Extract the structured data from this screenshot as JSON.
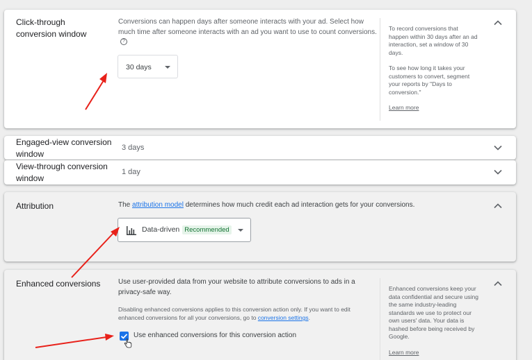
{
  "click_through": {
    "title": "Click-through conversion window",
    "description": "Conversions can happen days after someone interacts with your ad. Select how much time after someone interacts with an ad you want to use to count conversions.",
    "help": "?",
    "selected": "30 days",
    "side_para1": "To record conversions that happen within 30 days after an ad interaction, set a window of 30 days.",
    "side_para2": "To see how long it takes your customers to convert, segment your reports by \"Days to conversion.\"",
    "learn_more": "Learn more"
  },
  "engaged_view": {
    "title": "Engaged-view conversion window",
    "value": "3 days"
  },
  "view_through": {
    "title": "View-through conversion window",
    "value": "1 day"
  },
  "attribution": {
    "title": "Attribution",
    "desc_prefix": "The",
    "desc_link": "attribution model",
    "desc_suffix": "determines how much credit each ad interaction gets for your conversions.",
    "selected": "Data-driven",
    "badge": "Recommended"
  },
  "enhanced": {
    "title": "Enhanced conversions",
    "description": "Use user-provided data from your website to attribute conversions to ads in a privacy-safe way.",
    "note_prefix": "Disabling enhanced conversions applies to this conversion action only. If you want to edit enhanced conversions for all your conversions, go to",
    "note_link": "conversion settings",
    "note_suffix": ".",
    "checkbox_label": "Use enhanced conversions for this conversion action",
    "checkbox_checked": true,
    "side_text": "Enhanced conversions keep your data confidential and secure using the same industry-leading standards we use to protect our own users' data. Your data is hashed before being received by Google.",
    "learn_more": "Learn more"
  },
  "colors": {
    "link": "#1a73e8",
    "arrow": "#e8211a",
    "recommended_bg": "#e6f4ea",
    "recommended_text": "#137333"
  }
}
